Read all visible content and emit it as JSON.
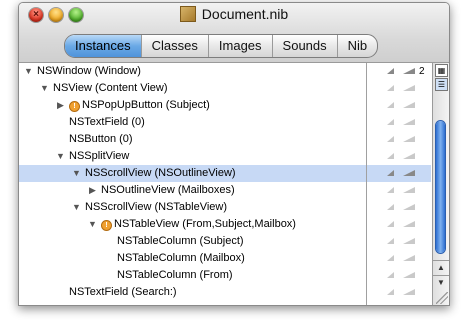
{
  "window": {
    "title": "Document.nib",
    "icon": "nib-document-icon",
    "controls": [
      "close",
      "minimize",
      "zoom"
    ]
  },
  "tabs": [
    {
      "label": "Instances",
      "active": true
    },
    {
      "label": "Classes",
      "active": false
    },
    {
      "label": "Images",
      "active": false
    },
    {
      "label": "Sounds",
      "active": false
    },
    {
      "label": "Nib",
      "active": false
    }
  ],
  "tree": [
    {
      "label": "NSWindow (Window)",
      "depth": 0,
      "expanded": true,
      "warning": false,
      "selected": false,
      "count": "2"
    },
    {
      "label": "NSView (Content View)",
      "depth": 1,
      "expanded": true,
      "warning": false,
      "selected": false,
      "count": ""
    },
    {
      "label": "NSPopUpButton (Subject)",
      "depth": 2,
      "expanded": false,
      "warning": true,
      "selected": false,
      "count": ""
    },
    {
      "label": "NSTextField (0)",
      "depth": 2,
      "expanded": null,
      "warning": false,
      "selected": false,
      "count": ""
    },
    {
      "label": "NSButton (0)",
      "depth": 2,
      "expanded": null,
      "warning": false,
      "selected": false,
      "count": ""
    },
    {
      "label": "NSSplitView",
      "depth": 2,
      "expanded": true,
      "warning": false,
      "selected": false,
      "count": ""
    },
    {
      "label": "NSScrollView (NSOutlineView)",
      "depth": 3,
      "expanded": true,
      "warning": false,
      "selected": true,
      "count": ""
    },
    {
      "label": "NSOutlineView (Mailboxes)",
      "depth": 4,
      "expanded": false,
      "warning": false,
      "selected": false,
      "count": ""
    },
    {
      "label": "NSScrollView (NSTableView)",
      "depth": 3,
      "expanded": true,
      "warning": false,
      "selected": false,
      "count": ""
    },
    {
      "label": "NSTableView (From,Subject,Mailbox)",
      "depth": 4,
      "expanded": true,
      "warning": true,
      "selected": false,
      "count": ""
    },
    {
      "label": "NSTableColumn (Subject)",
      "depth": 5,
      "expanded": null,
      "warning": false,
      "selected": false,
      "count": ""
    },
    {
      "label": "NSTableColumn (Mailbox)",
      "depth": 5,
      "expanded": null,
      "warning": false,
      "selected": false,
      "count": ""
    },
    {
      "label": "NSTableColumn (From)",
      "depth": 5,
      "expanded": null,
      "warning": false,
      "selected": false,
      "count": ""
    },
    {
      "label": "NSTextField (Search:)",
      "depth": 2,
      "expanded": null,
      "warning": false,
      "selected": false,
      "count": ""
    }
  ],
  "icons": {
    "expanded": "▼",
    "collapsed": "▶",
    "warning": "!",
    "scroll_up": "▲",
    "scroll_down": "▼",
    "view_mode_icon": "▦",
    "list_mode_icon": "☰",
    "close": "×"
  },
  "colors": {
    "selection": "#c7d9f5",
    "tab_active": "#6aa9e6",
    "warning": "#f0a030",
    "scroll_thumb": "#2e6fd1"
  }
}
